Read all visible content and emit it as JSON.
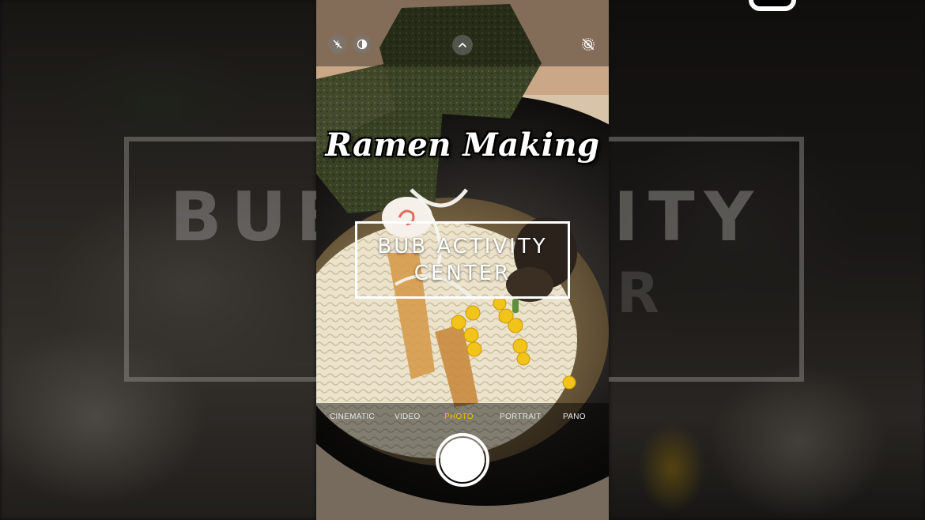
{
  "overlay": {
    "title": "Ramen Making",
    "logo_line1": "BUB ACTIVITY",
    "logo_line2": "CENTER"
  },
  "background": {
    "ghost_left": "BUB",
    "ghost_right": "ITY",
    "ghost_right2": "R"
  },
  "camera": {
    "top_controls": {
      "flash_icon": "flash-off-icon",
      "live_icon": "live-photo-icon",
      "expand_icon": "chevron-up-icon",
      "live_off_icon": "live-off-icon"
    },
    "modes": [
      {
        "label": "CINEMATIC"
      },
      {
        "label": "VIDEO"
      },
      {
        "label": "PHOTO",
        "active": true
      },
      {
        "label": "PORTRAIT"
      },
      {
        "label": "PANO"
      }
    ],
    "accent_color": "#f5c200"
  }
}
